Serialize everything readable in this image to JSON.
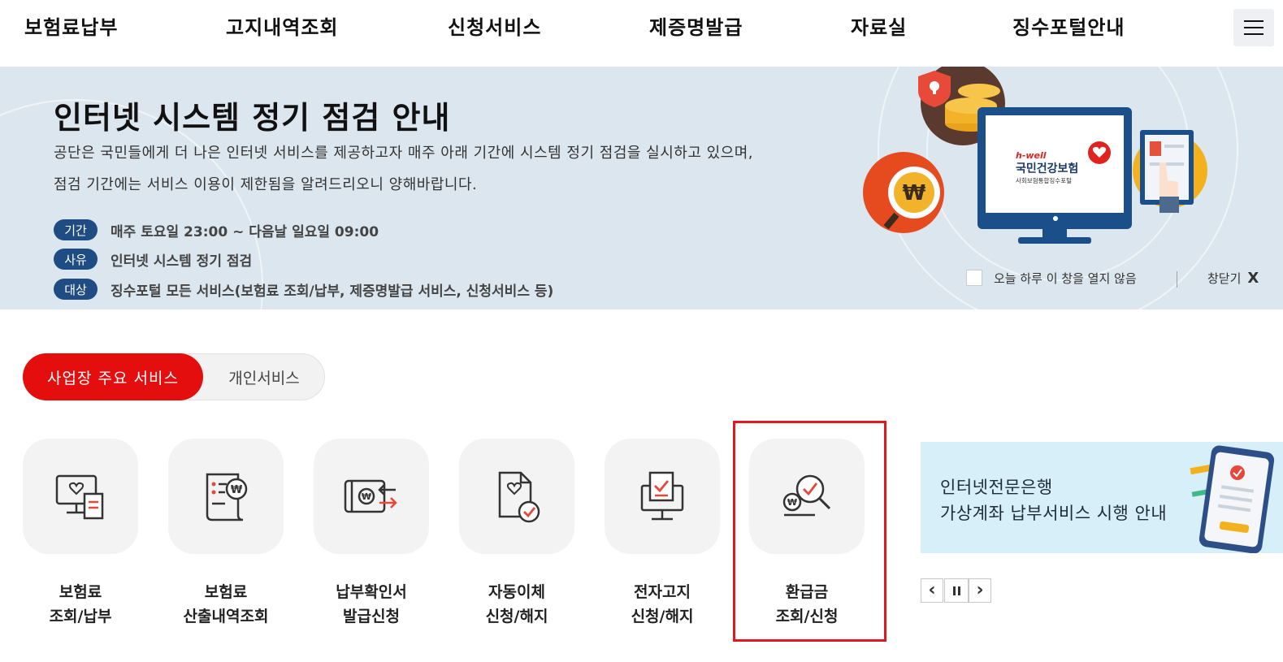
{
  "nav": {
    "items": [
      "보험료납부",
      "고지내역조회",
      "신청서비스",
      "제증명발급",
      "자료실",
      "징수포털안내"
    ]
  },
  "notice": {
    "title": "인터넷 시스템 정기 점검 안내",
    "desc_line1": "공단은 국민들에게 더 나은 인터넷 서비스를 제공하고자 매주 아래 기간에 시스템 정기 점검을 실시하고 있으며,",
    "desc_line2": "점검 기간에는 서비스 이용이 제한됨을 알려드리오니 양해바랍니다.",
    "rows": [
      {
        "tag": "기간",
        "value": "매주 토요일 23:00 ~ 다음날 일요일 09:00"
      },
      {
        "tag": "사유",
        "value": "인터넷 시스템 정기 점검"
      },
      {
        "tag": "대상",
        "value": "징수포털 모든 서비스(보험료 조회/납부, 제증명발급 서비스, 신청서비스 등)"
      }
    ],
    "dont_show_today": "오늘 하루 이 창을 열지 않음",
    "close_label": "창닫기",
    "close_x": "X",
    "illustration": {
      "brand_small": "h-well",
      "brand_main": "국민건강보험",
      "brand_sub": "사회보험통합징수포털"
    }
  },
  "tabs": {
    "business": "사업장 주요 서비스",
    "personal": "개인서비스"
  },
  "services": [
    {
      "line1": "보험료",
      "line2": "조회/납부",
      "icon": "monitor-receipt-icon"
    },
    {
      "line1": "보험료",
      "line2": "산출내역조회",
      "icon": "scroll-won-icon"
    },
    {
      "line1": "납부확인서",
      "line2": "발급신청",
      "icon": "card-won-transfer-icon"
    },
    {
      "line1": "자동이체",
      "line2": "신청/해지",
      "icon": "document-check-icon"
    },
    {
      "line1": "전자고지",
      "line2": "신청/해지",
      "icon": "computer-check-icon"
    },
    {
      "line1": "환급금",
      "line2": "조회/신청",
      "icon": "magnifier-won-icon"
    }
  ],
  "promo": {
    "line1": "인터넷전문은행",
    "line2": "가상계좌 납부서비스 시행 안내"
  },
  "carousel": {
    "prev": "‹",
    "pause": "॥",
    "next": "›"
  },
  "colors": {
    "accent_red": "#e50e0e",
    "tag_blue": "#1f4d83",
    "banner_bg": "#dce6ee",
    "promo_bg": "#d7eff8"
  }
}
